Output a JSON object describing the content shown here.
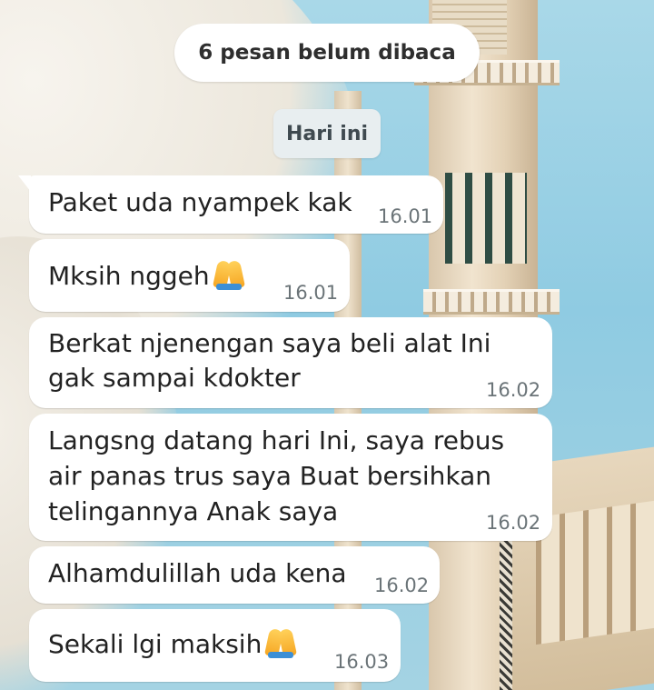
{
  "chat": {
    "unread_banner": "6 pesan belum dibaca",
    "date_separator": "Hari ini",
    "messages": [
      {
        "lines": [
          "Paket uda nyampek kak"
        ],
        "time": "16.01",
        "emoji": ""
      },
      {
        "lines": [
          "Mksih nggeh"
        ],
        "time": "16.01",
        "emoji": "folded-hands-icon"
      },
      {
        "lines": [
          "Berkat njenengan saya beli alat Ini",
          "gak sampai kdokter"
        ],
        "time": "16.02",
        "emoji": ""
      },
      {
        "lines": [
          "Langsng datang hari Ini, saya rebus",
          "air panas trus saya Buat bersihkan",
          "telingannya Anak saya"
        ],
        "time": "16.02",
        "emoji": ""
      },
      {
        "lines": [
          "Alhamdulillah uda kena"
        ],
        "time": "16.02",
        "emoji": ""
      },
      {
        "lines": [
          "Sekali lgi maksih"
        ],
        "time": "16.03",
        "emoji": "folded-hands-icon"
      }
    ]
  },
  "colors": {
    "bubble": "#ffffff",
    "text": "#222222",
    "timestamp": "#6b7478",
    "sky": "#8fcbe2"
  }
}
